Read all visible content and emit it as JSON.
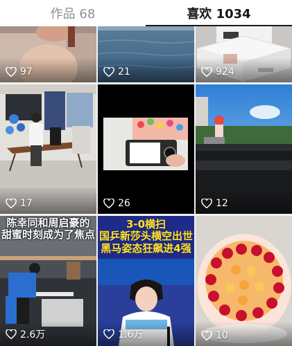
{
  "tabs": {
    "works": "作品 68",
    "likes": "喜欢 1034"
  },
  "videos": [
    {
      "likes": "97"
    },
    {
      "likes": "21"
    },
    {
      "likes": "924"
    },
    {
      "likes": "17"
    },
    {
      "likes": "26"
    },
    {
      "likes": "12"
    },
    {
      "likes": "2.6万",
      "overlay_line1": "陈幸同和周启豪的",
      "overlay_line2": "甜蜜时刻成为了焦点"
    },
    {
      "likes": "1.6万",
      "overlay_line1": "3-0横扫",
      "overlay_line2": "国乒新莎头横空出世",
      "overlay_line3": "黑马姿态狂飙进4强"
    },
    {
      "likes": "10"
    }
  ]
}
